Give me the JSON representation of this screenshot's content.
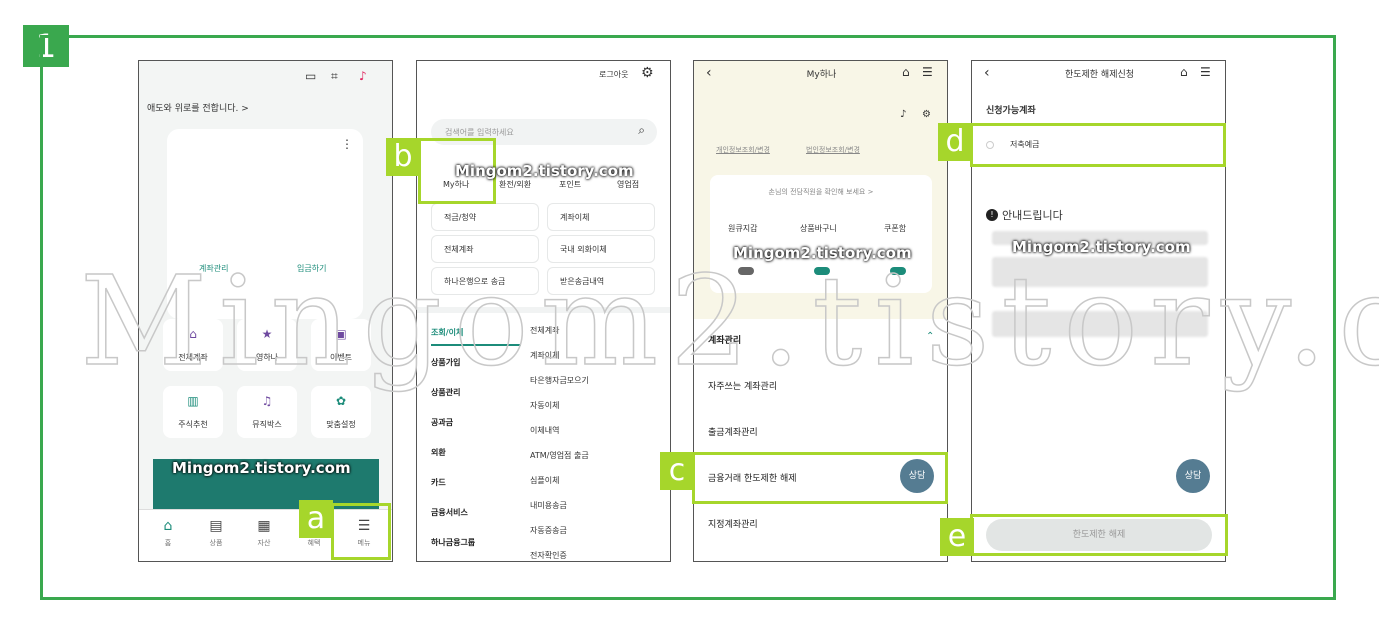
{
  "step_number": "1",
  "watermark": "Mingom2.tistory.com",
  "markers": {
    "a": "a",
    "b": "b",
    "c": "c",
    "d": "d",
    "e": "e"
  },
  "phone1": {
    "notice": "애도와 위로를 전합니다. >",
    "account_manage": "계좌관리",
    "deposit": "입금하기",
    "grid": [
      {
        "label": "전체계좌",
        "icon": "home-icon"
      },
      {
        "label": "영하나",
        "icon": "star-icon"
      },
      {
        "label": "이벤트",
        "icon": "gift-icon"
      },
      {
        "label": "주식추천",
        "icon": "chart-icon"
      },
      {
        "label": "뮤직박스",
        "icon": "music-icon"
      },
      {
        "label": "맞춤설정",
        "icon": "gear-icon"
      }
    ],
    "tabs": [
      {
        "label": "홈",
        "icon": "home-tab-icon"
      },
      {
        "label": "상품",
        "icon": "product-tab-icon"
      },
      {
        "label": "자산",
        "icon": "asset-tab-icon"
      },
      {
        "label": "혜택",
        "icon": "benefit-tab-icon"
      },
      {
        "label": "메뉴",
        "icon": "menu-tab-icon"
      }
    ]
  },
  "phone2": {
    "logout": "로그아웃",
    "search_placeholder": "검색어를 입력하세요",
    "top_shortcuts": [
      "My하나",
      "환전/외환",
      "포인트",
      "영업점"
    ],
    "quick": [
      "적금/청약",
      "계좌이체",
      "전체계좌",
      "국내 외화이체",
      "하나은행으로 송금",
      "받은송금내역"
    ],
    "left_categories": [
      "조회/이체",
      "상품가입",
      "상품관리",
      "공과금",
      "외환",
      "카드",
      "금융서비스",
      "하나금융그룹"
    ],
    "right_items": [
      "전체계좌",
      "계좌이체",
      "타은행자금모으기",
      "자동이체",
      "이체내역",
      "ATM/영업점 출금",
      "심플이체",
      "내미용송금",
      "자동증송금",
      "전자확인증"
    ]
  },
  "phone3": {
    "title": "My하나",
    "link1": "개인정보조회/변경",
    "link2": "법인정보조회/변경",
    "banner": "손님의 전담직원을 확인해 보세요 >",
    "menu_items": [
      "원큐지갑",
      "상품바구니",
      "쿠폰함"
    ],
    "section": "계좌관리",
    "rows": [
      "자주쓰는 계좌관리",
      "출금계좌관리",
      "금융거래 한도제한 해제",
      "지정계좌관리"
    ],
    "consult": "상담"
  },
  "phone4": {
    "title": "한도제한 해제신청",
    "subtitle": "신청가능계좌",
    "account": "저축예금",
    "info_title": "안내드립니다",
    "consult": "상담",
    "submit": "한도제한 해제"
  }
}
